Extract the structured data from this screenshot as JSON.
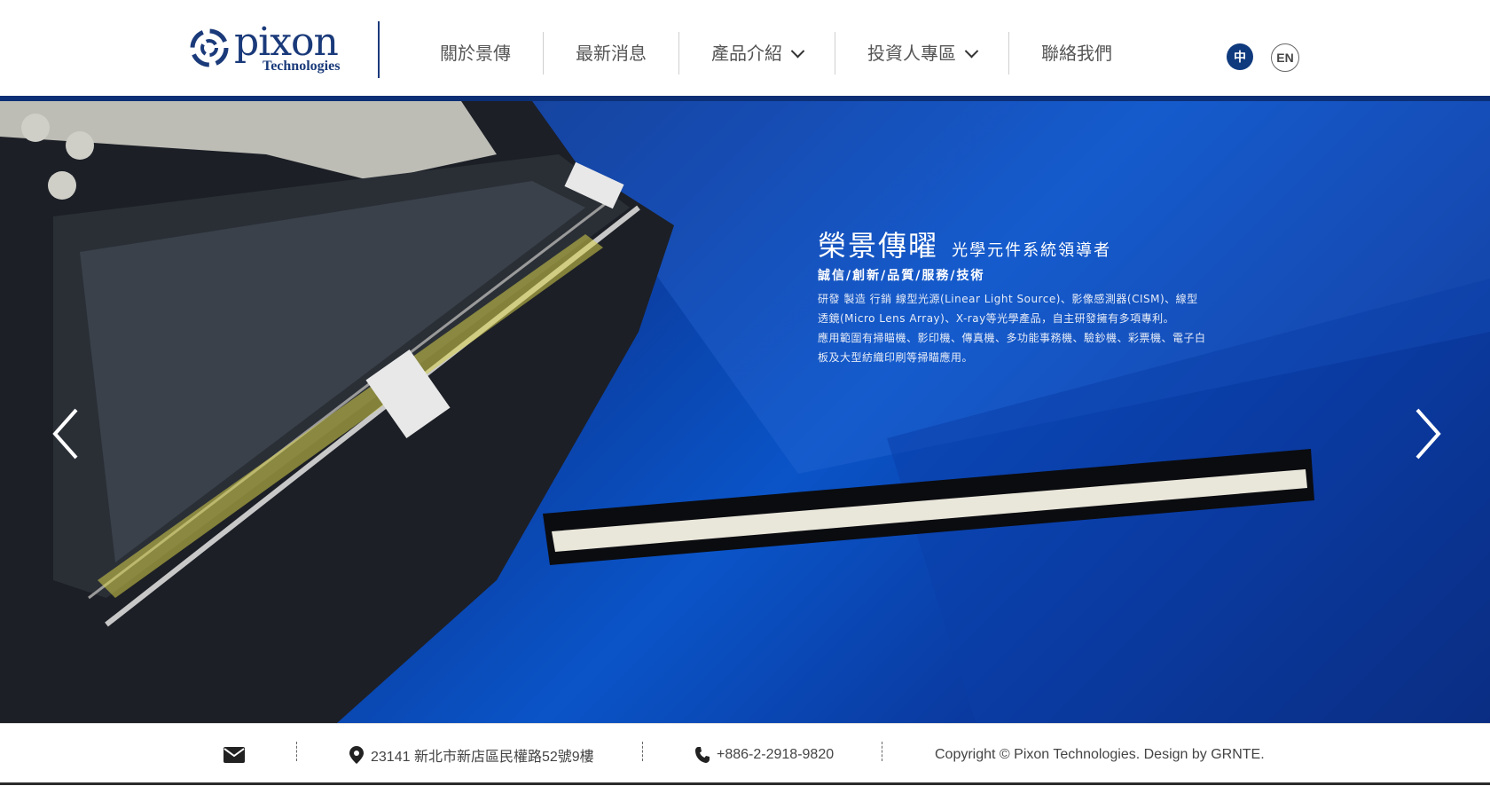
{
  "header": {
    "logo_text": "pixon",
    "logo_sub": "Technologies",
    "nav": [
      {
        "label": "關於景傳",
        "has_dropdown": false
      },
      {
        "label": "最新消息",
        "has_dropdown": false
      },
      {
        "label": "產品介紹",
        "has_dropdown": true
      },
      {
        "label": "投資人專區",
        "has_dropdown": true
      },
      {
        "label": "聯絡我們",
        "has_dropdown": false
      }
    ],
    "lang_zh": "中",
    "lang_en": "EN"
  },
  "hero": {
    "title_part1": "榮",
    "title_green": "景傳",
    "title_part2": "曜",
    "subtitle": "光學元件系統領導者",
    "values": "誠信/創新/品質/服務/技術",
    "desc_line1": "研發 製造 行銷  線型光源(Linear Light Source)、影像感測器(CISM)、線型",
    "desc_line2": "透鏡(Micro Lens Array)、X-ray等光學產品，自主研發擁有多項專利。",
    "desc_line3": "應用範圍有掃瞄機、影印機、傳真機、多功能事務機、驗鈔機、彩票機、電子白",
    "desc_line4": "板及大型紡織印刷等掃瞄應用。"
  },
  "footer": {
    "address": "23141 新北市新店區民權路52號9樓",
    "phone": "+886-2-2918-9820",
    "copyright": "Copyright © Pixon Technologies. Design by GRNTE."
  },
  "colors": {
    "brand": "#0f3a7d",
    "accent_green": "#7ed321"
  }
}
